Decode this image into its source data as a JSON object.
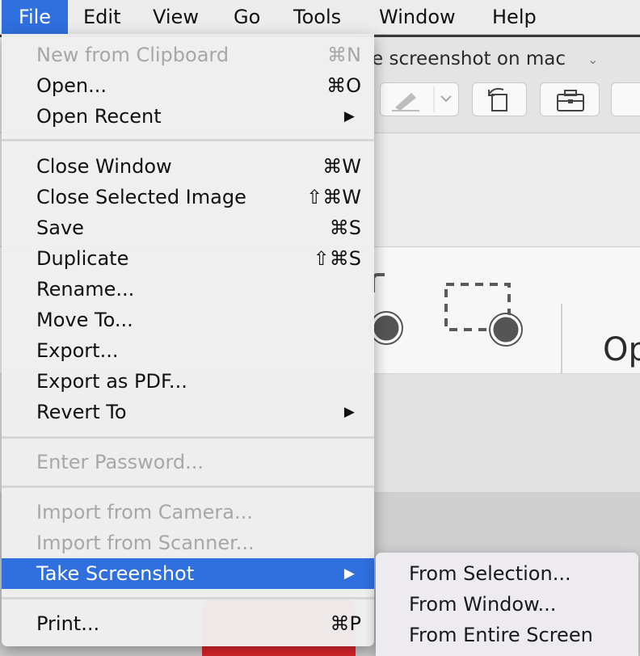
{
  "menubar": {
    "items": [
      "File",
      "Edit",
      "View",
      "Go",
      "Tools",
      "Window",
      "Help"
    ],
    "active_item": "File"
  },
  "background_window": {
    "title": "e screenshot on mac",
    "partial_text": "Op"
  },
  "file_menu": {
    "items": [
      {
        "label": "New from Clipboard",
        "shortcut": "⌘N",
        "enabled": false
      },
      {
        "label": "Open...",
        "shortcut": "⌘O",
        "enabled": true
      },
      {
        "label": "Open Recent",
        "submenu": true,
        "enabled": true
      },
      {
        "label": "Close Window",
        "shortcut": "⌘W",
        "enabled": true
      },
      {
        "label": "Close Selected Image",
        "shortcut": "⇧⌘W",
        "enabled": true
      },
      {
        "label": "Save",
        "shortcut": "⌘S",
        "enabled": true
      },
      {
        "label": "Duplicate",
        "shortcut": "⇧⌘S",
        "enabled": true
      },
      {
        "label": "Rename...",
        "enabled": true
      },
      {
        "label": "Move To...",
        "enabled": true
      },
      {
        "label": "Export...",
        "enabled": true
      },
      {
        "label": "Export as PDF...",
        "enabled": true
      },
      {
        "label": "Revert To",
        "submenu": true,
        "enabled": true
      },
      {
        "label": "Enter Password...",
        "enabled": false
      },
      {
        "label": "Import from Camera...",
        "enabled": false
      },
      {
        "label": "Import from Scanner...",
        "enabled": false
      },
      {
        "label": "Take Screenshot",
        "submenu": true,
        "enabled": true,
        "highlighted": true
      },
      {
        "label": "Print...",
        "shortcut": "⌘P",
        "enabled": true
      }
    ],
    "submenu_arrow": "▶"
  },
  "take_screenshot_submenu": {
    "items": [
      "From Selection...",
      "From Window...",
      "From Entire Screen"
    ]
  },
  "colors": {
    "highlight": "#2f6fde",
    "disabled_text": "#a7a7a7",
    "menu_bg": "#eeeeee"
  }
}
